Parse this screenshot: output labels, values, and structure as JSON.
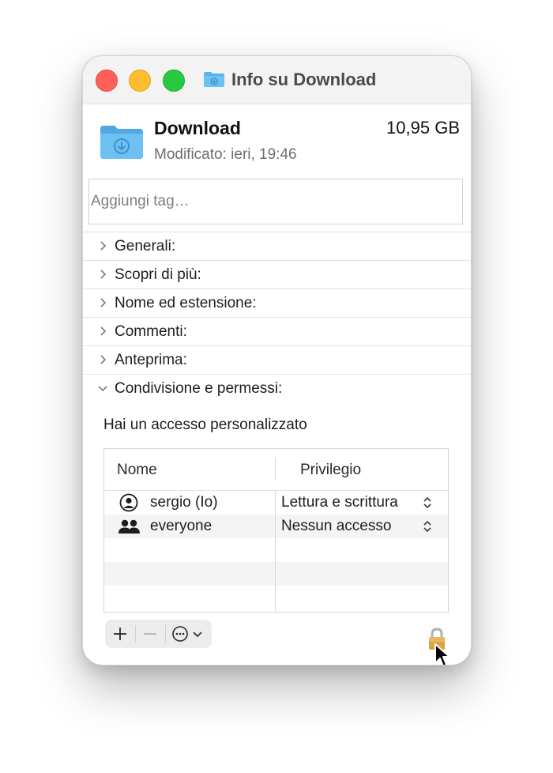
{
  "window": {
    "title": "Info su Download",
    "accent_folder_color": "#5ab4ec"
  },
  "header": {
    "name": "Download",
    "size": "10,95 GB",
    "modified": "Modificato: ieri, 19:46"
  },
  "tags": {
    "placeholder": "Aggiungi tag…"
  },
  "sections": [
    {
      "label": "Generali:",
      "expanded": false
    },
    {
      "label": "Scopri di più:",
      "expanded": false
    },
    {
      "label": "Nome ed estensione:",
      "expanded": false
    },
    {
      "label": "Commenti:",
      "expanded": false
    },
    {
      "label": "Anteprima:",
      "expanded": false
    },
    {
      "label": "Condivisione e permessi:",
      "expanded": true
    }
  ],
  "permissions": {
    "access_text": "Hai un accesso personalizzato",
    "columns": [
      "Nome",
      "Privilegio"
    ],
    "rows": [
      {
        "name": "sergio (Io)",
        "privilege": "Lettura e scrittura",
        "icon": "user-icon"
      },
      {
        "name": "everyone",
        "privilege": "Nessun accesso",
        "icon": "group-icon"
      }
    ]
  },
  "toolbar": {
    "buttons": [
      "plus-icon",
      "minus-icon",
      "ellipsis-icon",
      "chevron-down-icon"
    ]
  },
  "lock": {
    "icon": "lock-icon",
    "state": "locked"
  }
}
